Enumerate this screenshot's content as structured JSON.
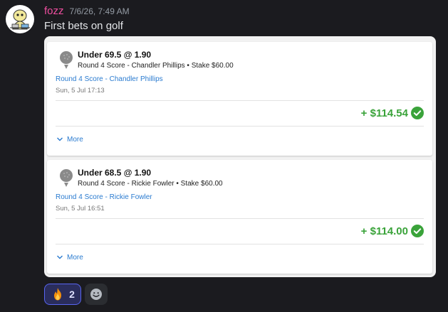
{
  "message": {
    "username": "fozz",
    "timestamp": "7/6/26, 7:49 AM",
    "text": "First bets on golf"
  },
  "bets": [
    {
      "title": "Under 69.5 @ 1.90",
      "subtitle": "Round 4 Score - Chandler Phillips • Stake $60.00",
      "link": "Round 4 Score - Chandler Phillips",
      "date": "Sun, 5 Jul 17:13",
      "payout": "+ $114.54",
      "more_label": "More"
    },
    {
      "title": "Under 68.5 @ 1.90",
      "subtitle": "Round 4 Score - Rickie Fowler • Stake $60.00",
      "link": "Round 4 Score - Rickie Fowler",
      "date": "Sun, 5 Jul 16:51",
      "payout": "+ $114.00",
      "more_label": "More"
    }
  ],
  "reactions": [
    {
      "emoji": "fire-icon",
      "count": "2"
    }
  ],
  "icons": {
    "bet_sport": "golf-ball-icon",
    "settled": "check-circle-icon",
    "expand": "chevron-down-icon",
    "add_reaction": "add-reaction-icon"
  },
  "colors": {
    "username": "#f04fa0",
    "win": "#3aa33a",
    "link": "#2a7bd0",
    "reaction_border": "#5865f2"
  }
}
